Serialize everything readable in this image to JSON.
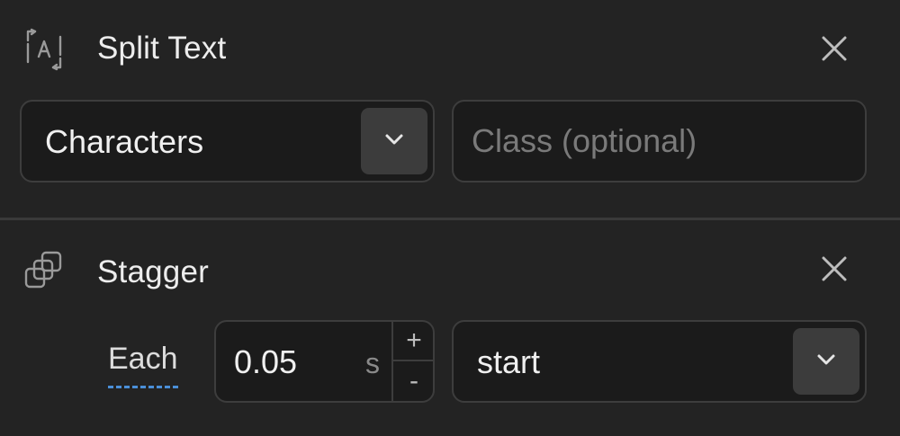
{
  "split_text": {
    "icon": "split-text-icon",
    "title": "Split Text",
    "close_icon": "close-icon",
    "mode": {
      "value": "Characters",
      "chevron_icon": "chevron-down-icon"
    },
    "class_input": {
      "value": "",
      "placeholder": "Class (optional)"
    }
  },
  "stagger": {
    "icon": "stagger-icon",
    "title": "Stagger",
    "close_icon": "close-icon",
    "each_label": "Each",
    "amount": {
      "value": "0.05",
      "unit": "s",
      "increment": "+",
      "decrement": "-"
    },
    "from": {
      "value": "start",
      "chevron_icon": "chevron-down-icon"
    }
  },
  "colors": {
    "background": "#232323",
    "field_bg": "#1b1b1b",
    "field_border": "#3d3d3d",
    "chevron_bg": "#3c3c3c",
    "accent_underline": "#4a8fd8",
    "placeholder": "#7a7a7a"
  }
}
